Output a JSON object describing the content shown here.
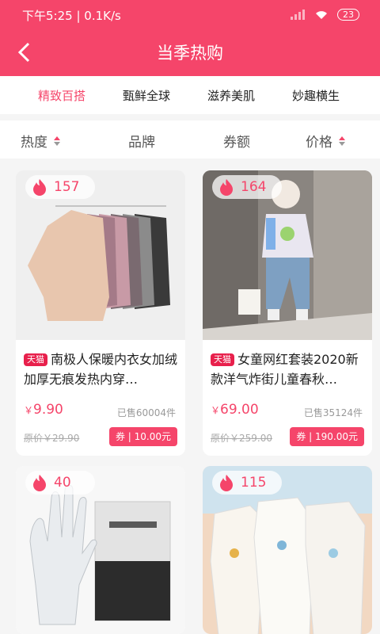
{
  "status_bar": {
    "time_speed": "下午5:25 | 0.1K/s",
    "battery": "23"
  },
  "header": {
    "title": "当季热购"
  },
  "tabs": [
    {
      "label": "精致百搭",
      "active": true
    },
    {
      "label": "甄鲜全球",
      "active": false
    },
    {
      "label": "滋养美肌",
      "active": false
    },
    {
      "label": "妙趣横生",
      "active": false
    }
  ],
  "sort": {
    "heat": "热度",
    "brand": "品牌",
    "coupon": "券额",
    "price": "价格"
  },
  "products": [
    {
      "heat": "157",
      "tag": "天猫",
      "name": "南极人保暖内衣女加绒加厚无痕发热内穿…",
      "price": "9.90",
      "sold": "已售60004件",
      "original": "原价￥29.90",
      "coupon": "券 | 10.00元"
    },
    {
      "heat": "164",
      "tag": "天猫",
      "name": "女童网红套装2020新款洋气炸街儿童春秋…",
      "price": "69.00",
      "sold": "已售35124件",
      "original": "原价￥259.00",
      "coupon": "券 | 190.00元"
    },
    {
      "heat": "40"
    },
    {
      "heat": "115"
    }
  ],
  "colors": {
    "accent": "#f5456a",
    "tag": "#e8204c"
  }
}
